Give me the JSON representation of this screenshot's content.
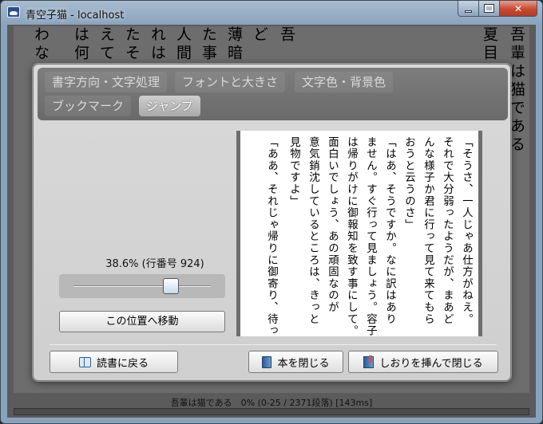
{
  "window": {
    "title": "青空子猫 - localhost"
  },
  "background_text": {
    "columns": [
      "吾輩は猫である",
      "夏目漱石",
      "",
      "",
      "",
      "",
      "",
      "",
      "",
      "",
      "",
      "",
      "",
      "",
      "",
      "吾",
      "ど",
      "薄暗",
      "た事",
      "人間",
      "れは",
      "たそ",
      "えて",
      "は何",
      "わな"
    ]
  },
  "status": {
    "text": "吾輩は猫である　0% (0-25 / 2371段落) [143ms]"
  },
  "dialog": {
    "tabs": [
      {
        "label": "書字方向・文字処理",
        "active": false
      },
      {
        "label": "フォントと大きさ",
        "active": false
      },
      {
        "label": "文字色・背景色",
        "active": false
      },
      {
        "label": "ブックマーク",
        "active": false
      },
      {
        "label": "ジャンプ",
        "active": true
      }
    ],
    "position_label": "38.6% (行番号 924)",
    "slider_value_percent": 38.6,
    "move_button": "この位置へ移動",
    "preview_columns": [
      "「そうさ、一人じゃあ仕方がねえ。",
      "それで大分弱ったようだが、まあど",
      "んな様子か君に行って見て来てもら",
      "おうと云うのさ」",
      "「はあ、そうですか。なに訳はあり",
      "ません。すぐ行って見ましょう。容子",
      "は帰りがけに御報知を致す事にして。",
      "面白いでしょう、あの頑固なのが",
      "意気銷沈しているところは、きっと",
      "見物ですよ」",
      "「ああ、それじゃ帰りに御寄り、待っ"
    ],
    "back_button": "読書に戻る",
    "close_book_button": "本を閉じる",
    "bookmark_close_button": "しおりを挿んで閉じる"
  }
}
